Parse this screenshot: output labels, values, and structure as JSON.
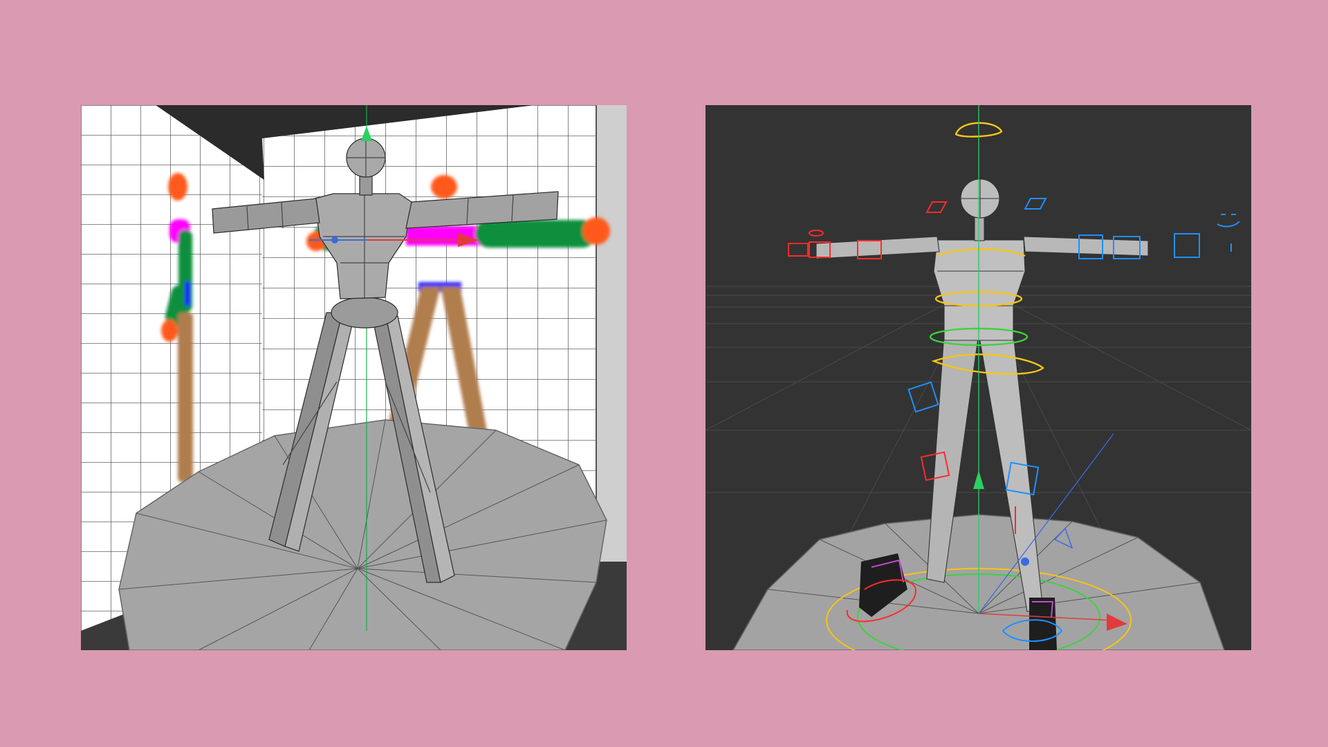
{
  "page": {
    "background_color": "#d99ab2",
    "panels": [
      {
        "id": "reference-setup",
        "viewport_background": "#ffffff",
        "floor_color": "#a0a0a0",
        "wall_grid_color": "#333333",
        "reference_sketch_colors": {
          "head": "#ff5a1f",
          "shoulders": "#ff00ff",
          "arms": "#0a8f3c",
          "legs": "#b07d4d",
          "feet": "#55c3ea",
          "hips": "#1a1aff"
        },
        "mesh_color": "#9d9d9d"
      },
      {
        "id": "rigged-character",
        "viewport_background": "#333333",
        "floor_color": "#9a9a9a",
        "mesh_color": "#b5b5b5",
        "control_colors": {
          "left_side": "#ff2a2a",
          "right_side": "#1e90ff",
          "center": "#f5c518",
          "hips": "#3fd13f"
        }
      }
    ]
  }
}
